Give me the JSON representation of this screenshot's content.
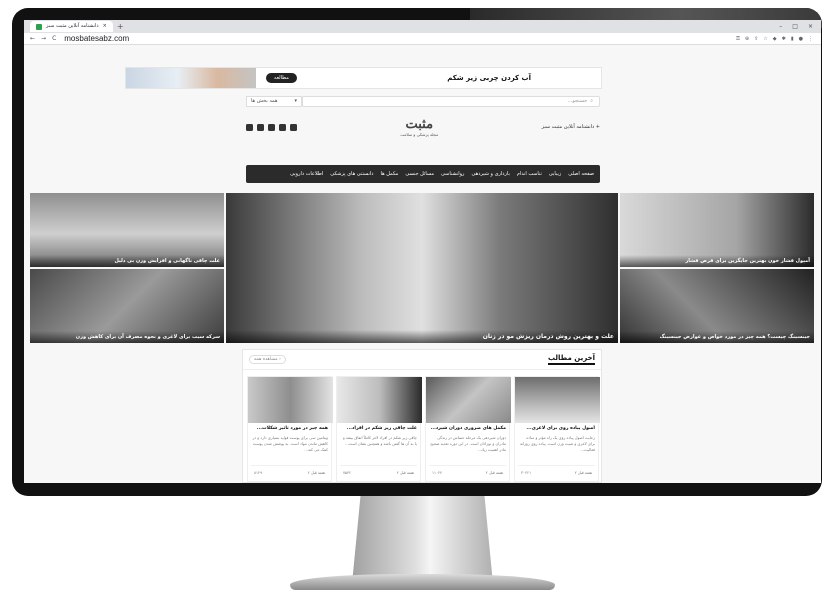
{
  "browser": {
    "tab_title": "دانشنامه آنلاین مثبت سبز",
    "new_tab": "+",
    "window_controls": [
      "–",
      "□",
      "×"
    ],
    "nav": [
      "←",
      "→",
      "C"
    ],
    "url": "mosbatesabz.com"
  },
  "banner": {
    "button_label": "مطالعه",
    "title": "آب کردن چربی زیر شکم"
  },
  "search": {
    "placeholder": "جستجو...",
    "select_value": "همه بخش ها"
  },
  "header": {
    "logo_text": "مثبت",
    "logo_subtitle": "مجله پزشکی و سلامت",
    "add_shortcut": "دانشنامه آنلاین مثبت سبز"
  },
  "navbar": {
    "items": [
      "صفحه اصلی",
      "زیبایی",
      "تناسب اندام",
      "بارداری و شیردهی",
      "روانشناسی",
      "مسائل جنسی",
      "مکمل ها",
      "دانستنی های پزشکی",
      "اطلاعات دارویی"
    ]
  },
  "hero": {
    "main_caption": "علت و بهترین روش درمان ریزش مو در زنان",
    "left_top": "علت چاقی ناگهانی و افزایش وزن بی دلیل",
    "left_bottom": "سرکه سیب برای لاغری و نحوه مصرف آن برای کاهش وزن",
    "right_top": "آمپول فشار خون بهترین جایگزین برای قرص فشار",
    "right_bottom": "جینسینگ چیست؟ همه چیز در مورد خواص و عوارض جینسینگ"
  },
  "latest": {
    "title": "آخرین مطالب",
    "more": "مشاهده همه",
    "cards": [
      {
        "title": "اصول پیاده روی برای لاغری...",
        "desc": "رعایت اصول پیاده روی یک راه مؤثر و ساده برای لاغری و تثبیت وزن است. پیاده روی روزانه فعالیت...",
        "date": "۲ هفته قبل",
        "views": "۳۰۲۲۱"
      },
      {
        "title": "مکمل های ضروری دوران شیرد...",
        "desc": "دوران شیردهی یک مرحله حساس در زندگی مادران و نوزادان است. در این دوره تغذیه صحیح مادر اهمیت زیاد...",
        "date": "۲ هفته قبل",
        "views": "۱۱۰۲۴"
      },
      {
        "title": "علت چاقی زیر شکم در افراد...",
        "desc": "چاقی زیر شکم در افراد لاغر کاملاً اتفاق بیفتد و یا به آن ها گفتن باشد و همچنین نشان است...",
        "date": "۲ هفته قبل",
        "views": "۷۵۴۲"
      },
      {
        "title": "همه چیز در مورد تاثیر شکلات...",
        "desc": "ویتامین سی برای پوست فواید بسیاری دارد و در کاهش ماندن مواد است. به پوشش شدن پوست کمک می کند...",
        "date": "۲ هفته قبل",
        "views": "۸۱۲۹"
      }
    ]
  }
}
